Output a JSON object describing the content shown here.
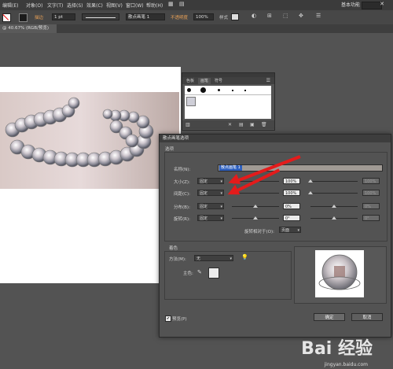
{
  "menubar": {
    "items": [
      "编辑(E)",
      "对象(O)",
      "文字(T)",
      "选择(S)",
      "效果(C)",
      "视图(V)",
      "窗口(W)",
      "帮助(H)"
    ],
    "workspace": "基本功能"
  },
  "controlbar": {
    "stroke_label": "描边",
    "stroke_value": "1 pt",
    "brush_label": "散点画笔 1",
    "opacity_label": "不透明度",
    "opacity_value": "100%",
    "style_label": "样式"
  },
  "document": {
    "tab_label": "@ 40.67% (RGB/预览)"
  },
  "brush_panel": {
    "tabs": [
      "色板",
      "画笔",
      "符号"
    ],
    "active_tab": "画笔"
  },
  "dialog": {
    "title": "散点画笔选项",
    "options_header": "选项",
    "name_label": "名称(N):",
    "name_value": "散点画笔 1",
    "rows": [
      {
        "label": "大小(Z):",
        "mode": "固定",
        "value": "100%",
        "value2": "100%"
      },
      {
        "label": "间距(C):",
        "mode": "固定",
        "value": "100%",
        "value2": "100%"
      },
      {
        "label": "分布(B):",
        "mode": "固定",
        "value": "0%",
        "value2": "0%"
      },
      {
        "label": "旋转(R):",
        "mode": "固定",
        "value": "0°",
        "value2": "0°"
      }
    ],
    "rotation_relative_label": "旋转相对于(O):",
    "rotation_relative_value": "页面",
    "colorize_header": "着色",
    "method_label": "方法(M):",
    "method_value": "无",
    "keycolor_label": "主色:",
    "preview_label": "预览(P)",
    "ok_label": "确定",
    "cancel_label": "取消"
  },
  "watermark": {
    "text": "Bai 经验",
    "sub": "jingyan.baidu.com"
  },
  "colors": {
    "arrow": "#e41b1b",
    "highlight": "#e86a17"
  }
}
